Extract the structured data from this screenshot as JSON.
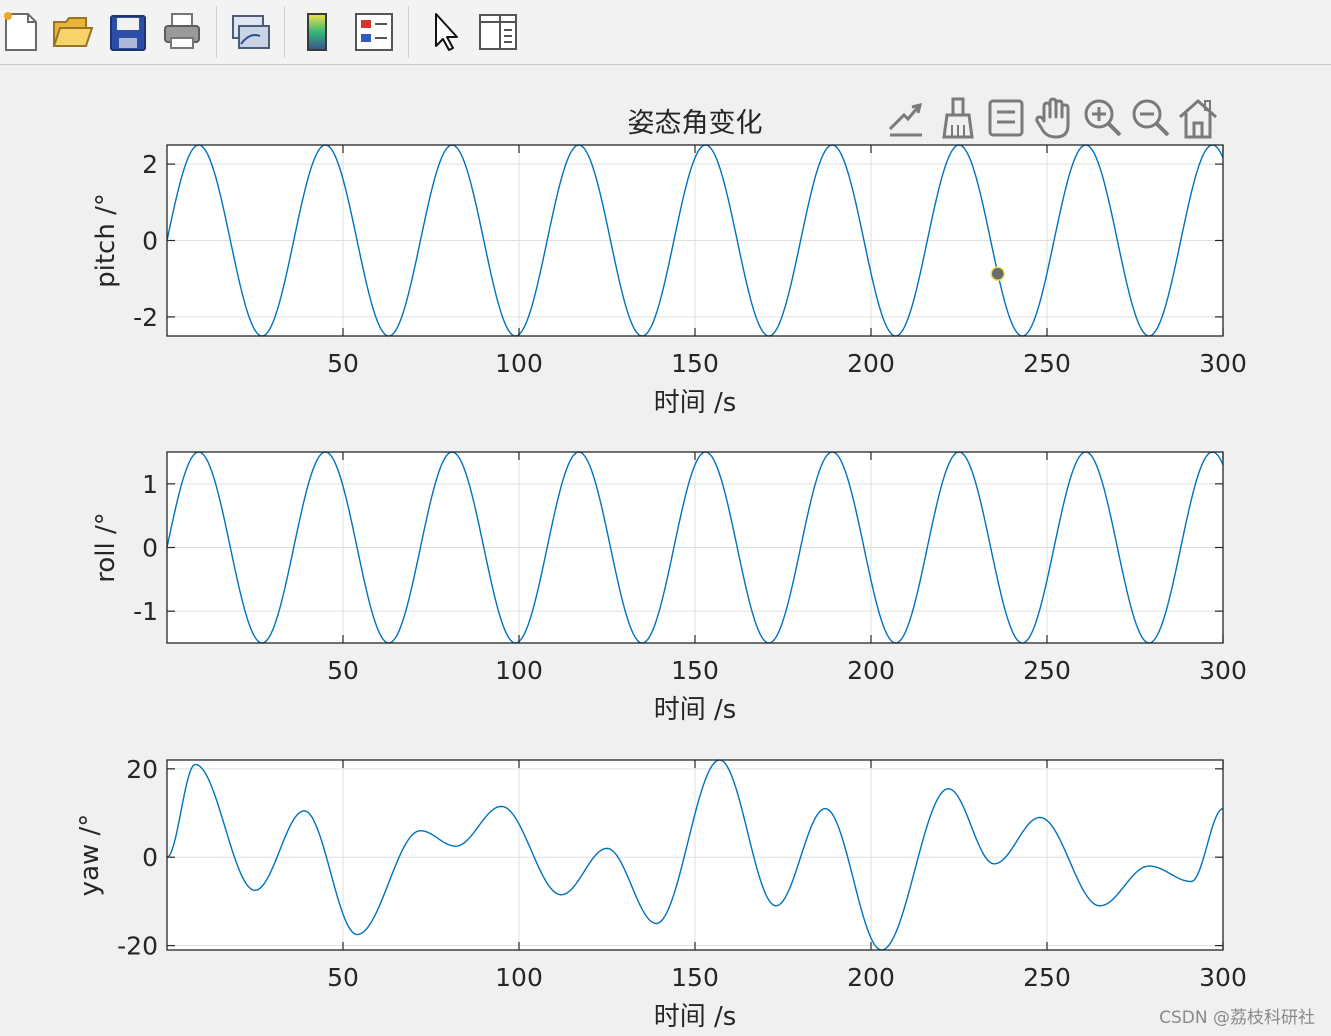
{
  "toolbar": {
    "items": [
      {
        "icon": "new-figure-icon"
      },
      {
        "icon": "open-file-icon"
      },
      {
        "icon": "save-icon"
      },
      {
        "icon": "print-icon"
      },
      {
        "icon": "link-plot-icon"
      },
      {
        "icon": "colorbar-icon"
      },
      {
        "icon": "legend-icon"
      },
      {
        "icon": "edit-plot-arrow-icon"
      },
      {
        "icon": "property-inspector-icon"
      }
    ]
  },
  "axes_toolbar": {
    "items": [
      {
        "icon": "export-icon"
      },
      {
        "icon": "brush-icon"
      },
      {
        "icon": "data-tips-icon"
      },
      {
        "icon": "pan-hand-icon"
      },
      {
        "icon": "zoom-in-icon"
      },
      {
        "icon": "zoom-out-icon"
      },
      {
        "icon": "restore-view-home-icon"
      }
    ]
  },
  "figure_title": "姿态角变化",
  "watermark": "CSDN @荔枝科研社",
  "colors": {
    "line": "#0072bd",
    "axes_bg": "#ffffff",
    "figure_bg": "#f0f0f0",
    "grid": "#dfdfdf",
    "axis": "#262626"
  },
  "chart_data": [
    {
      "type": "line",
      "title": "姿态角变化",
      "xlabel": "时间 /s",
      "ylabel": "pitch /°",
      "xlim": [
        0,
        300
      ],
      "ylim": [
        -2.5,
        2.5
      ],
      "xticks": [
        50,
        100,
        150,
        200,
        250,
        300
      ],
      "yticks": [
        -2,
        0,
        2
      ],
      "ytick_labels": [
        "-2",
        "0",
        "2"
      ],
      "grid": true,
      "series": [
        {
          "function": "sine",
          "amplitude": 2.5,
          "period": 36,
          "phase_deg": 0
        }
      ],
      "marker": {
        "x": 236,
        "y": -0.87
      }
    },
    {
      "type": "line",
      "title": "",
      "xlabel": "时间 /s",
      "ylabel": "roll /°",
      "xlim": [
        0,
        300
      ],
      "ylim": [
        -1.5,
        1.5
      ],
      "xticks": [
        50,
        100,
        150,
        200,
        250,
        300
      ],
      "yticks": [
        -1,
        0,
        1
      ],
      "ytick_labels": [
        "-1",
        "0",
        "1"
      ],
      "grid": true,
      "series": [
        {
          "function": "sine",
          "amplitude": 1.5,
          "period": 36,
          "phase_deg": 0
        }
      ]
    },
    {
      "type": "line",
      "title": "",
      "xlabel": "时间 /s",
      "ylabel": "yaw /°",
      "xlim": [
        0,
        300
      ],
      "ylim": [
        -21,
        22
      ],
      "xticks": [
        50,
        100,
        150,
        200,
        250,
        300
      ],
      "yticks": [
        -20,
        0,
        20
      ],
      "ytick_labels": [
        "-20",
        "0",
        "20"
      ],
      "grid": true,
      "series": [
        {
          "points": [
            [
              0,
              0
            ],
            [
              8,
              21
            ],
            [
              25,
              -7.5
            ],
            [
              39,
              10.5
            ],
            [
              54,
              -17.5
            ],
            [
              72,
              6
            ],
            [
              82,
              2.5
            ],
            [
              95,
              11.5
            ],
            [
              112,
              -8.5
            ],
            [
              125,
              2
            ],
            [
              139,
              -15
            ],
            [
              157,
              22
            ],
            [
              173,
              -11
            ],
            [
              187,
              11
            ],
            [
              203,
              -21
            ],
            [
              222,
              15.5
            ],
            [
              235,
              -1.5
            ],
            [
              248,
              9
            ],
            [
              265,
              -11
            ],
            [
              279,
              -2
            ],
            [
              291,
              -5.5
            ],
            [
              300,
              11
            ]
          ]
        }
      ]
    }
  ]
}
